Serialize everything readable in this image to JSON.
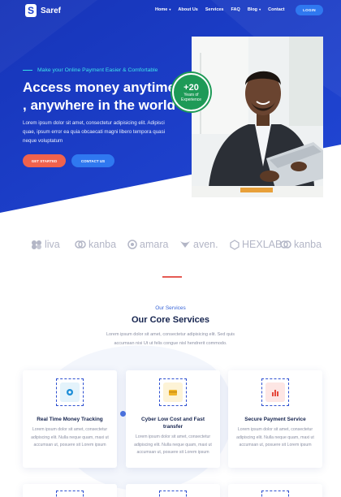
{
  "brand": {
    "logo_letter": "S",
    "name": "Saref"
  },
  "nav": {
    "items": [
      {
        "label": "Home",
        "dropdown": true
      },
      {
        "label": "About Us",
        "dropdown": false
      },
      {
        "label": "Services",
        "dropdown": false
      },
      {
        "label": "FAQ",
        "dropdown": false
      },
      {
        "label": "Blog",
        "dropdown": true
      },
      {
        "label": "Contact",
        "dropdown": false
      }
    ],
    "login_label": "LOGIN"
  },
  "hero": {
    "tagline": "Make your Online Payment Easier & Comfortable",
    "title": "Access money anytime , anywhere in the world",
    "description": "Lorem ipsum dolor sit amet, consectetur adipisicing elit. Adipisci quae, ipsum error ea quia obcaecati magni libero tempora quasi neque voluptatum",
    "start_label": "GET STARTED",
    "contact_label": "CONTACT US",
    "badge_number": "+20",
    "badge_text_1": "Years of",
    "badge_text_2": "Experience"
  },
  "partners": [
    "liva",
    "kanba",
    "amara",
    "aven.",
    "HEXLAB",
    "kanba"
  ],
  "services": {
    "subtitle": "Our Services",
    "title": "Our Core Services",
    "description": "Lorem ipsum dolor sit amet, consectetur adipisicing elit. Sed quis accumsan nisi Ut ut felis congue nisl hendrerit commodo.",
    "cards": [
      {
        "title": "Real Time Money Tracking",
        "text": "Lorem ipsum dolor sit amet, consectetur adipiscing elit. Nulla neque quam, maxi ut accumsan ut, posuere sit Lorem ipsum",
        "icon": "tracking-icon"
      },
      {
        "title": "Cyber Low Cost and Fast transfer",
        "text": "Lorem ipsum dolor sit amet, consectetur adipiscing elit. Nulla neque quam, maxi ut accumsan ut, posuere sit Lorem ipsum",
        "icon": "transfer-icon"
      },
      {
        "title": "Secure Payment Service",
        "text": "Lorem ipsum dolor sit amet, consectetur adipiscing elit. Nulla neque quam, maxi ut accumsan ut, posuere sit Lorem ipsum",
        "icon": "payment-icon"
      }
    ]
  },
  "colors": {
    "hero_blue": "#1a3bc7",
    "accent_orange": "#f0624d",
    "accent_blue": "#2f78f0",
    "accent_cyan": "#3ee2ea",
    "badge_green": "#1e9a57"
  }
}
